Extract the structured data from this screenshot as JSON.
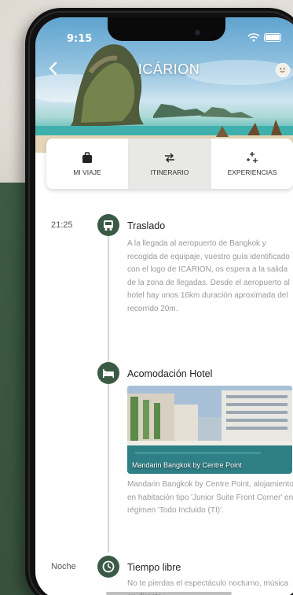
{
  "status_bar": {
    "time": "9:15"
  },
  "header": {
    "title": "ICÁRION"
  },
  "tabs": [
    {
      "label": "MI VIAJE",
      "icon": "suitcase-icon",
      "active": false
    },
    {
      "label": "ITINERARIO",
      "icon": "plane-arrows-icon",
      "active": true
    },
    {
      "label": "EXPERIENCIAS",
      "icon": "sparkle-icon",
      "active": false
    }
  ],
  "itinerary": [
    {
      "time": "21:25",
      "icon": "transfer-bus-icon",
      "title": "Traslado",
      "description": "A la llegada al aeropuerto de Bangkok y recogida de equipaje, vuestro guía identificado con el logo de ICÁRION, os espera a la salida de la zona de llegadas. Desde el aeropuerto al hotel hay unos 16km duración aproximada del recorrido 20m."
    },
    {
      "time": "",
      "icon": "bed-icon",
      "title": "Acomodación Hotel",
      "image_caption": "Mandarin Bangkok by Centre Point",
      "description": "Mandarin Bangkok by Centre Point, alojamiento en habitación tipo 'Junior Suite Front Corner' en régimen 'Todo Incluido (TI)'."
    },
    {
      "time": "Noche",
      "icon": "clock-icon",
      "title": "Tiempo libre",
      "description": "No te pierdas el espectáculo nocturno, música en directo"
    }
  ],
  "colors": {
    "accent_green": "#3a5a44",
    "background_green": "#3d5a43"
  }
}
